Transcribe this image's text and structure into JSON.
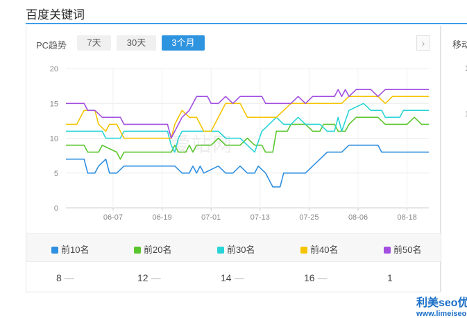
{
  "page_title": "百度关键词",
  "pc_label": "PC趋势",
  "mobile_label": "移动",
  "mobile_ticks": [
    "1",
    "1"
  ],
  "range_tabs": [
    {
      "label": "7天",
      "active": false
    },
    {
      "label": "30天",
      "active": false
    },
    {
      "label": "3个月",
      "active": true
    }
  ],
  "next_icon": "chevron-right-icon",
  "watermark": "爱站网",
  "brand": {
    "name": "利美seo优化",
    "url": "www.limeiseo.com"
  },
  "rank_row": [
    "8",
    "12",
    "14",
    "16",
    "1"
  ],
  "rank_dash": "—",
  "chart_data": {
    "type": "line",
    "ylim": [
      0,
      20
    ],
    "yticks": [
      0,
      5,
      10,
      15,
      20
    ],
    "xlim": [
      0,
      100
    ],
    "xticks": [
      {
        "label": "06-07",
        "x": 13
      },
      {
        "label": "06-19",
        "x": 26.5
      },
      {
        "label": "07-01",
        "x": 40
      },
      {
        "label": "07-13",
        "x": 53.5
      },
      {
        "label": "07-25",
        "x": 67
      },
      {
        "label": "08-06",
        "x": 80.5
      },
      {
        "label": "08-18",
        "x": 94
      }
    ],
    "grid": true,
    "legend_position": "bottom",
    "series": [
      {
        "name": "前10名",
        "color": "#2f8fe0",
        "points": [
          [
            0,
            7
          ],
          [
            5,
            7
          ],
          [
            6,
            5
          ],
          [
            8,
            5
          ],
          [
            9,
            6
          ],
          [
            11,
            7
          ],
          [
            12,
            5
          ],
          [
            14,
            5
          ],
          [
            16,
            6
          ],
          [
            30,
            6
          ],
          [
            32,
            5
          ],
          [
            34,
            5
          ],
          [
            35,
            6
          ],
          [
            36,
            5
          ],
          [
            37,
            6
          ],
          [
            38,
            5
          ],
          [
            42,
            6
          ],
          [
            44,
            5
          ],
          [
            46,
            5
          ],
          [
            48,
            6
          ],
          [
            50,
            5
          ],
          [
            52,
            5
          ],
          [
            53,
            6
          ],
          [
            55,
            5
          ],
          [
            56,
            4
          ],
          [
            57,
            3
          ],
          [
            59,
            3
          ],
          [
            60,
            5
          ],
          [
            66,
            5
          ],
          [
            68,
            6
          ],
          [
            70,
            7
          ],
          [
            72,
            8
          ],
          [
            76,
            8
          ],
          [
            78,
            9
          ],
          [
            86,
            9
          ],
          [
            87,
            8
          ],
          [
            100,
            8
          ]
        ]
      },
      {
        "name": "前20名",
        "color": "#5ac52d",
        "points": [
          [
            0,
            9
          ],
          [
            5,
            9
          ],
          [
            6,
            8
          ],
          [
            9,
            8
          ],
          [
            10,
            9
          ],
          [
            14,
            8
          ],
          [
            15,
            7
          ],
          [
            16,
            8
          ],
          [
            29,
            8
          ],
          [
            30,
            9
          ],
          [
            31,
            8
          ],
          [
            33,
            8
          ],
          [
            34,
            9
          ],
          [
            35,
            8
          ],
          [
            36,
            9
          ],
          [
            40,
            9
          ],
          [
            42,
            10
          ],
          [
            44,
            9
          ],
          [
            48,
            9
          ],
          [
            50,
            10
          ],
          [
            52,
            9
          ],
          [
            54,
            9
          ],
          [
            55,
            8
          ],
          [
            57,
            8
          ],
          [
            58,
            11
          ],
          [
            61,
            11
          ],
          [
            62,
            12
          ],
          [
            66,
            12
          ],
          [
            68,
            11
          ],
          [
            70,
            11
          ],
          [
            71,
            12
          ],
          [
            74,
            12
          ],
          [
            75,
            11
          ],
          [
            77,
            11
          ],
          [
            78,
            12
          ],
          [
            80,
            13
          ],
          [
            86,
            13
          ],
          [
            88,
            12
          ],
          [
            94,
            12
          ],
          [
            96,
            13
          ],
          [
            98,
            12
          ],
          [
            100,
            12
          ]
        ]
      },
      {
        "name": "前30名",
        "color": "#28d4d6",
        "points": [
          [
            0,
            11
          ],
          [
            10,
            11
          ],
          [
            11,
            10
          ],
          [
            15,
            10
          ],
          [
            16,
            11
          ],
          [
            28,
            11
          ],
          [
            29,
            9
          ],
          [
            30,
            8
          ],
          [
            31,
            10
          ],
          [
            32,
            11
          ],
          [
            42,
            11
          ],
          [
            44,
            10
          ],
          [
            46,
            10
          ],
          [
            48,
            10
          ],
          [
            50,
            9
          ],
          [
            52,
            8
          ],
          [
            54,
            11
          ],
          [
            56,
            12
          ],
          [
            58,
            13
          ],
          [
            60,
            12
          ],
          [
            62,
            12
          ],
          [
            64,
            13
          ],
          [
            66,
            12
          ],
          [
            70,
            12
          ],
          [
            72,
            11
          ],
          [
            74,
            11
          ],
          [
            75,
            13
          ],
          [
            76,
            11
          ],
          [
            78,
            14
          ],
          [
            82,
            15
          ],
          [
            84,
            14
          ],
          [
            87,
            14
          ],
          [
            88,
            13
          ],
          [
            92,
            13
          ],
          [
            93,
            14
          ],
          [
            100,
            14
          ]
        ]
      },
      {
        "name": "前40名",
        "color": "#f5c400",
        "points": [
          [
            0,
            12
          ],
          [
            3,
            12
          ],
          [
            5,
            14
          ],
          [
            8,
            14
          ],
          [
            9,
            12
          ],
          [
            11,
            11
          ],
          [
            12,
            12
          ],
          [
            14,
            12
          ],
          [
            15,
            11
          ],
          [
            16,
            10
          ],
          [
            29,
            10
          ],
          [
            30,
            12
          ],
          [
            32,
            14
          ],
          [
            34,
            13
          ],
          [
            36,
            13
          ],
          [
            38,
            11
          ],
          [
            40,
            11
          ],
          [
            42,
            13
          ],
          [
            44,
            15
          ],
          [
            48,
            15
          ],
          [
            50,
            13
          ],
          [
            58,
            13
          ],
          [
            60,
            14
          ],
          [
            62,
            15
          ],
          [
            76,
            15
          ],
          [
            78,
            16
          ],
          [
            86,
            16
          ],
          [
            88,
            15
          ],
          [
            90,
            16
          ],
          [
            100,
            16
          ]
        ]
      },
      {
        "name": "前50名",
        "color": "#a24fe0",
        "points": [
          [
            0,
            15
          ],
          [
            5,
            15
          ],
          [
            6,
            14
          ],
          [
            8,
            14
          ],
          [
            10,
            13
          ],
          [
            15,
            13
          ],
          [
            16,
            12
          ],
          [
            28,
            12
          ],
          [
            29,
            10
          ],
          [
            30,
            11
          ],
          [
            32,
            13
          ],
          [
            34,
            14
          ],
          [
            36,
            16
          ],
          [
            39,
            16
          ],
          [
            40,
            15
          ],
          [
            42,
            15
          ],
          [
            44,
            16
          ],
          [
            46,
            15
          ],
          [
            48,
            16
          ],
          [
            54,
            16
          ],
          [
            55,
            15
          ],
          [
            62,
            15
          ],
          [
            64,
            16
          ],
          [
            66,
            15
          ],
          [
            68,
            16
          ],
          [
            74,
            16
          ],
          [
            75,
            17
          ],
          [
            76,
            16
          ],
          [
            77,
            17
          ],
          [
            78,
            16
          ],
          [
            80,
            17
          ],
          [
            84,
            17
          ],
          [
            86,
            16
          ],
          [
            88,
            17
          ],
          [
            100,
            17
          ]
        ]
      }
    ]
  }
}
